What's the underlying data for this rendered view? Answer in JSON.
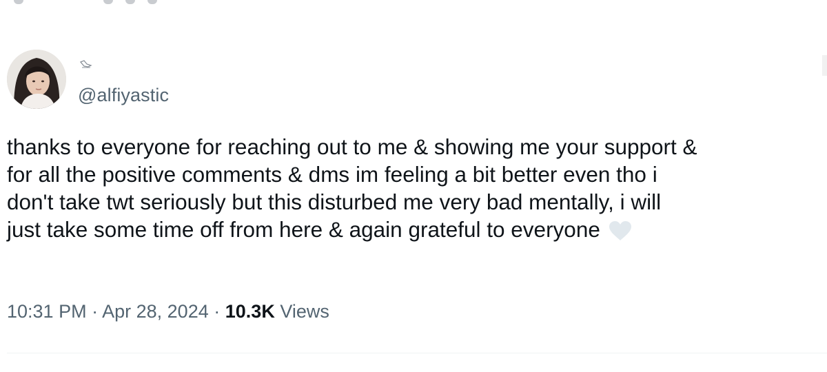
{
  "tweet": {
    "handle": "@alfiyastic",
    "text_lines": [
      "thanks to everyone for reaching out to me & showing me your support &",
      "for all the positive comments & dms im feeling a bit better even tho i",
      "don't take twt seriously but this disturbed me very bad mentally, i will",
      "just take some time off from here & again grateful to everyone"
    ],
    "emoji": "white-heart",
    "time": "10:31 PM",
    "separator": "·",
    "date": "Apr 28, 2024",
    "views_count": "10.3K",
    "views_label": "Views"
  },
  "icons": {
    "name_icon": "bird-glyph-icon"
  },
  "colors": {
    "text_primary": "#0f1419",
    "text_secondary": "#536471",
    "divider": "#eff3f4",
    "heart": "#e1e8ed"
  }
}
